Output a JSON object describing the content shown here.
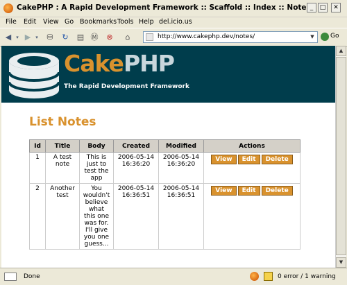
{
  "window": {
    "title": "CakePHP : A Rapid Development Framework :: Scaffold :: Index :: Notes - Mozilla Fir..."
  },
  "menu": [
    "File",
    "Edit",
    "View",
    "Go",
    "Bookmarks",
    "Tools",
    "Help",
    "del.icio.us"
  ],
  "toolbar": {
    "url": "http://www.cakephp.dev/notes/",
    "go_label": "Go"
  },
  "header": {
    "logo_cake": "Cake",
    "logo_php": "PHP",
    "subtitle": "The Rapid Development Framework"
  },
  "page": {
    "title": "List Notes"
  },
  "table": {
    "columns": [
      "Id",
      "Title",
      "Body",
      "Created",
      "Modified",
      "Actions"
    ],
    "rows": [
      {
        "id": "1",
        "title": "A test note",
        "body": "This is just to test the app",
        "created": "2006-05-14 16:36:20",
        "modified": "2006-05-14 16:36:20"
      },
      {
        "id": "2",
        "title": "Another test",
        "body": "You wouldn't believe what this one was for. I'll give you one guess...",
        "created": "2006-05-14 16:36:51",
        "modified": "2006-05-14 16:36:51"
      }
    ],
    "actions": [
      "View",
      "Edit",
      "Delete"
    ]
  },
  "status": {
    "text": "Done",
    "errors": "0 error / 1 warning"
  },
  "colors": {
    "header_bg": "#003d4c",
    "accent": "#d9922e"
  }
}
